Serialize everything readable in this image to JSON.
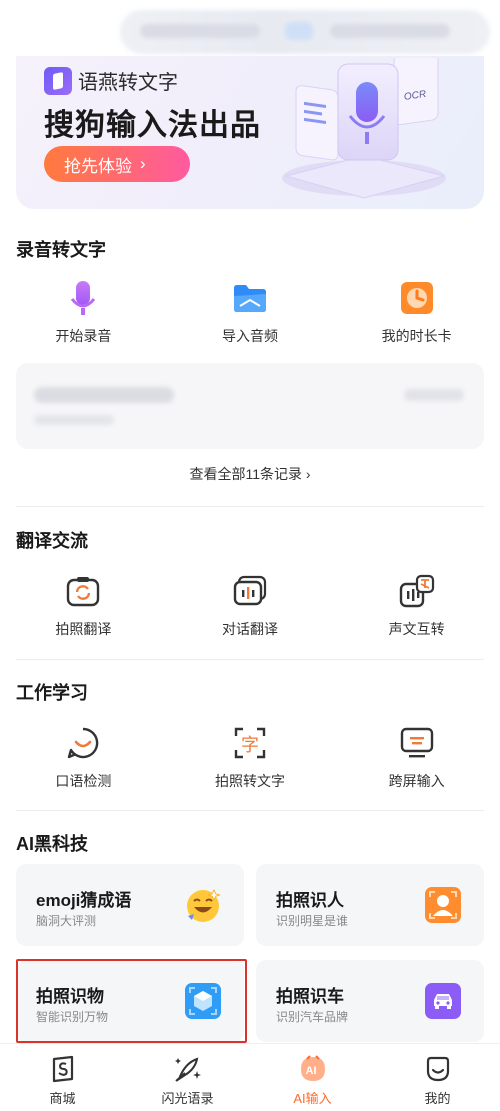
{
  "banner": {
    "brand_name": "语燕转文字",
    "title": "搜狗输入法出品",
    "cta_label": "抢先体验",
    "cta_arrow": "›",
    "art_badge": "OCR"
  },
  "recording": {
    "section_title": "录音转文字",
    "items": [
      {
        "label": "开始录音",
        "icon": "microphone-icon"
      },
      {
        "label": "导入音频",
        "icon": "folder-icon"
      },
      {
        "label": "我的时长卡",
        "icon": "clock-icon"
      }
    ],
    "view_all": "查看全部11条记录 ›"
  },
  "translate": {
    "section_title": "翻译交流",
    "items": [
      {
        "label": "拍照翻译",
        "icon": "camera-translate-icon"
      },
      {
        "label": "对话翻译",
        "icon": "dialog-translate-icon"
      },
      {
        "label": "声文互转",
        "icon": "voice-text-convert-icon"
      }
    ]
  },
  "work": {
    "section_title": "工作学习",
    "items": [
      {
        "label": "口语检测",
        "icon": "speech-check-icon"
      },
      {
        "label": "拍照转文字",
        "icon": "photo-to-text-icon"
      },
      {
        "label": "跨屏输入",
        "icon": "monitor-icon"
      }
    ],
    "photo_text_glyph": "字"
  },
  "ai_tech": {
    "section_title": "AI黑科技",
    "cards": [
      {
        "title": "emoji猜成语",
        "subtitle": "脑洞大评测",
        "icon": "emoji-icon"
      },
      {
        "title": "拍照识人",
        "subtitle": "识别明星是谁",
        "icon": "person-scan-icon"
      },
      {
        "title": "拍照识物",
        "subtitle": "智能识别万物",
        "icon": "object-scan-icon"
      },
      {
        "title": "拍照识车",
        "subtitle": "识别汽车品牌",
        "icon": "car-scan-icon"
      }
    ]
  },
  "tabbar": {
    "tabs": [
      {
        "label": "商城",
        "icon": "shop-icon"
      },
      {
        "label": "闪光语录",
        "icon": "quill-icon"
      },
      {
        "label": "AI输入",
        "icon": "ai-input-icon",
        "active": true,
        "badge": "AI"
      },
      {
        "label": "我的",
        "icon": "profile-icon"
      }
    ]
  },
  "colors": {
    "accent_orange": "#ff6a2b",
    "brand_purple": "#7b5cf6",
    "highlight_red": "#d9342b"
  }
}
